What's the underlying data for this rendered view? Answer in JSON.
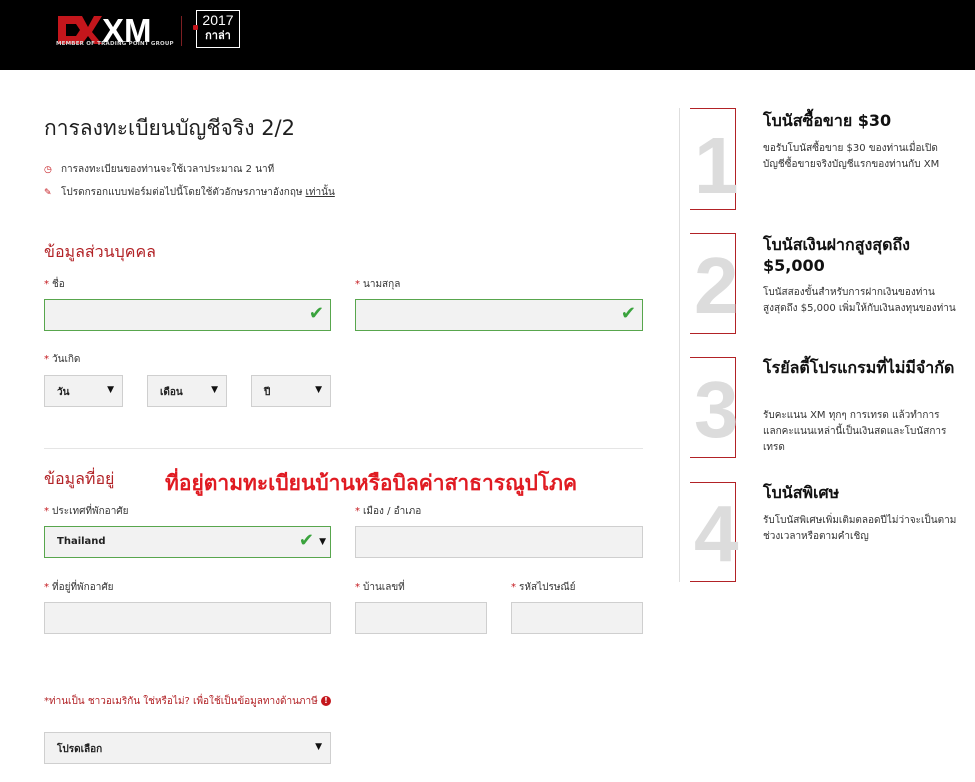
{
  "header": {
    "logo_text": "XM",
    "logo_tagline": "MEMBER OF TRADING POINT GROUP",
    "award_year": "2017",
    "award_word": "กาล่า"
  },
  "page": {
    "title": "การลงทะเบียนบัญชีจริง 2/2",
    "info_time": "การลงทะเบียนของท่านจะใช้เวลาประมาณ 2 นาที",
    "info_lang": "โปรดกรอกแบบฟอร์มต่อไปนี้โดยใช้ตัวอักษรภาษาอังกฤษ",
    "info_lang_emph": "เท่านั้น"
  },
  "personal": {
    "section": "ข้อมูลส่วนบุคคล",
    "first_name_label": "ชื่อ",
    "last_name_label": "นามสกุล",
    "dob_label": "วันเกิด",
    "day": "วัน",
    "month": "เดือน",
    "year": "ปี"
  },
  "address": {
    "section": "ข้อมูลที่อยู่",
    "annotation": "ที่อยู่ตามทะเบียนบ้านหรือบิลค่าสาธารณูปโภค",
    "country_label": "ประเทศที่พักอาศัย",
    "country_value": "Thailand",
    "city_label": "เมือง / อำเภอ",
    "street_label": "ที่อยู่ที่พักอาศัย",
    "house_label": "บ้านเลขที่",
    "zip_label": "รหัสไปรษณีย์"
  },
  "us": {
    "question": "*ท่านเป็น ชาวอเมริกัน ใช่หรือไม่? เพื่อใช้เป็นข้อมูลทางด้านภาษี",
    "select": "โปรดเลือก"
  },
  "bonuses": [
    {
      "num": "1",
      "title": "โบนัสซื้อขาย $30",
      "desc": "ขอรับโบนัสซื้อขาย $30 ของท่านเมื่อเปิดบัญชีซื้อขายจริงบัญชีแรกของท่านกับ XM"
    },
    {
      "num": "2",
      "title": "โบนัสเงินฝากสูงสุดถึง $5,000",
      "desc": "โบนัสสองขั้นสำหรับการฝากเงินของท่านสูงสุดถึง $5,000 เพิ่มให้กับเงินลงทุนของท่าน"
    },
    {
      "num": "3",
      "title": "โรยัลตี้โปรแกรมที่ไม่มีจำกัด",
      "desc": "รับคะแนน XM ทุกๆ การเทรด แล้วทำการแลกคะแนนเหล่านี้เป็นเงินสดและโบนัสการเทรด"
    },
    {
      "num": "4",
      "title": "โบนัสพิเศษ",
      "desc": "รับโบนัสพิเศษเพิ่มเติมตลอดปีไม่ว่าจะเป็นตามช่วงเวลาหรือตามคำเชิญ"
    }
  ],
  "colors": {
    "brand_red": "#c4161c",
    "section_red": "#b22226",
    "valid_green": "#3aa33d",
    "header_bg": "#000000"
  }
}
